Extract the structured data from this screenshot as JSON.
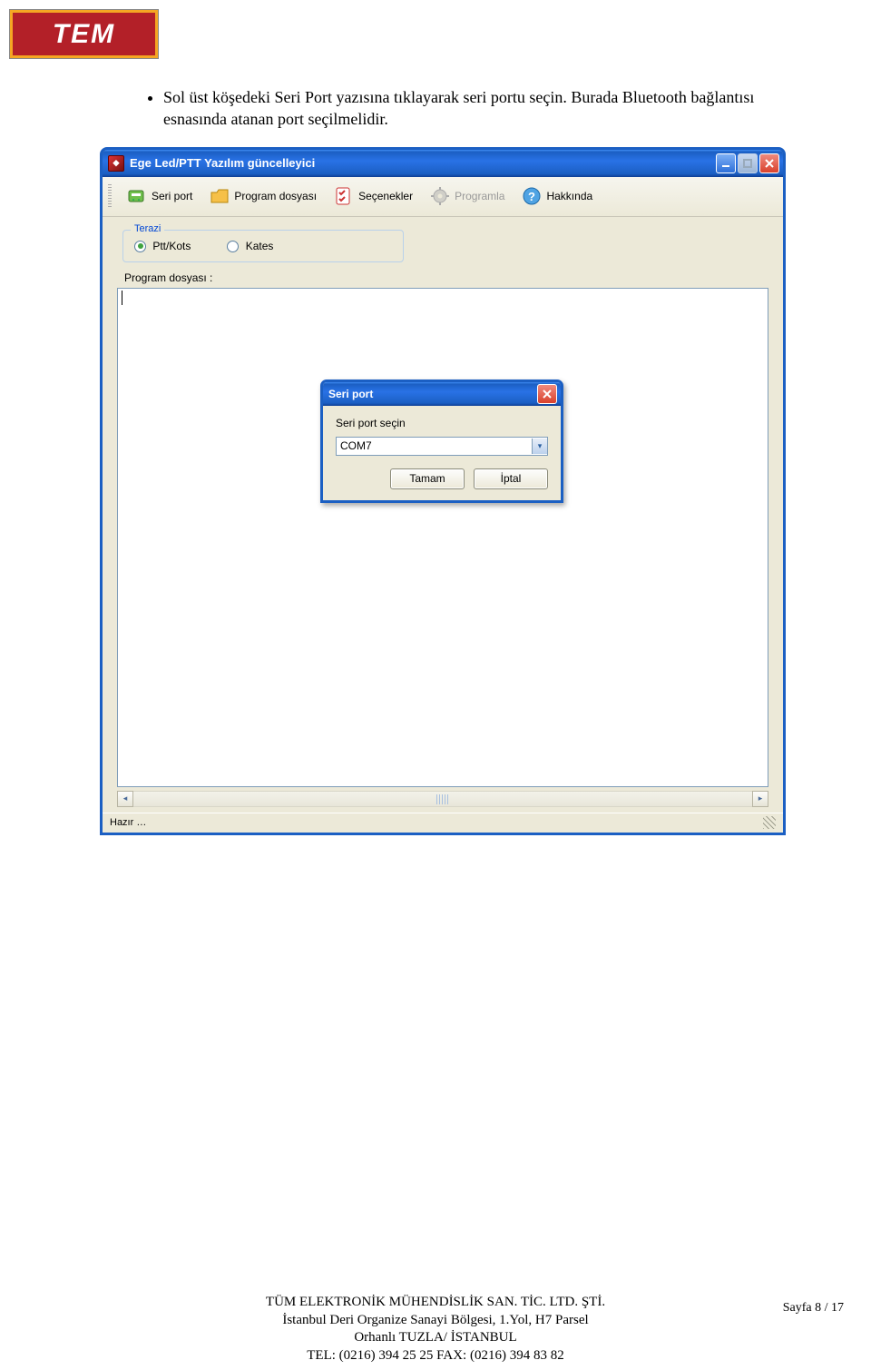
{
  "logo": {
    "text": "TEM"
  },
  "paragraph": "Sol üst köşedeki Seri Port yazısına tıklayarak seri portu  seçin. Burada Bluetooth bağlantısı esnasında atanan port seçilmelidir.",
  "window": {
    "title": "Ege Led/PTT Yazılım güncelleyici",
    "toolbar": {
      "seri_port": "Seri port",
      "program_dosyasi": "Program dosyası",
      "secenekler": "Seçenekler",
      "programla": "Programla",
      "hakkinda": "Hakkında"
    },
    "group": {
      "title": "Terazi",
      "opt1": "Ptt/Kots",
      "opt2": "Kates"
    },
    "program_dosyasi_label": "Program dosyası :",
    "status": "Hazır …"
  },
  "dialog": {
    "title": "Seri port",
    "label": "Seri port seçin",
    "combo_value": "COM7",
    "ok": "Tamam",
    "cancel": "İptal"
  },
  "footer": {
    "line1": "TÜM ELEKTRONİK MÜHENDİSLİK SAN. TİC. LTD. ŞTİ.",
    "line2": "İstanbul Deri Organize Sanayi Bölgesi, 1.Yol, H7 Parsel",
    "line3": "Orhanlı TUZLA/ İSTANBUL",
    "line4": "TEL: (0216) 394 25 25 FAX: (0216) 394 83 82",
    "page": "Sayfa 8 / 17"
  }
}
